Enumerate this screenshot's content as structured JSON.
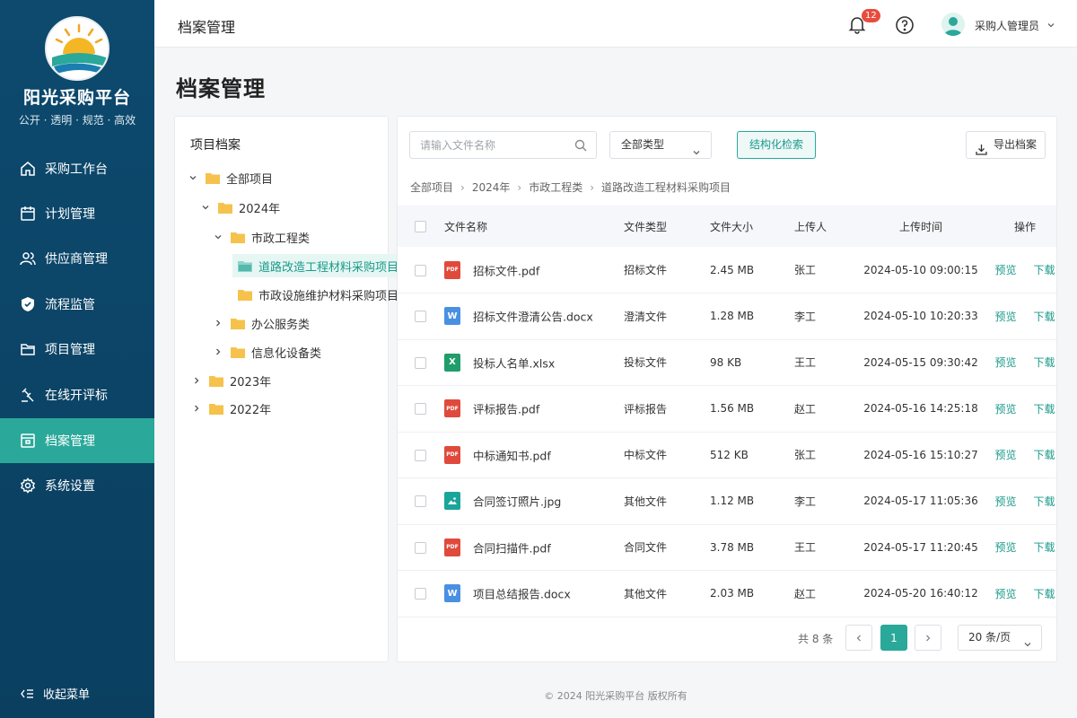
{
  "brand": {
    "title": "阳光采购平台",
    "subtitle": "公开 · 透明 · 规范 · 高效",
    "logo_icon": "sunrise-logo-icon"
  },
  "sidebar": {
    "items": [
      {
        "label": "采购工作台",
        "icon": "home-icon"
      },
      {
        "label": "计划管理",
        "icon": "calendar-icon"
      },
      {
        "label": "供应商管理",
        "icon": "users-icon"
      },
      {
        "label": "流程监管",
        "icon": "shield-icon"
      },
      {
        "label": "项目管理",
        "icon": "folder-icon"
      },
      {
        "label": "在线开评标",
        "icon": "gavel-icon"
      },
      {
        "label": "档案管理",
        "icon": "archive-icon",
        "active": true
      },
      {
        "label": "系统设置",
        "icon": "gear-icon"
      }
    ],
    "collapse_label": "收起菜单"
  },
  "header": {
    "title": "档案管理",
    "notification_count": "12",
    "user_name": "采购人管理员"
  },
  "page": {
    "title": "档案管理"
  },
  "tree": {
    "title": "项目档案",
    "nodes": [
      {
        "label": "全部项目",
        "expanded": true
      },
      {
        "label": "2024年",
        "expanded": true
      },
      {
        "label": "市政工程类",
        "expanded": true
      },
      {
        "label": "道路改造工程材料采购项目",
        "selected": true
      },
      {
        "label": "市政设施维护材料采购项目"
      },
      {
        "label": "办公服务类",
        "expanded": false
      },
      {
        "label": "信息化设备类",
        "expanded": false
      },
      {
        "label": "2023年",
        "expanded": false
      },
      {
        "label": "2022年",
        "expanded": false
      }
    ]
  },
  "toolbar": {
    "search_placeholder": "请输入文件名称",
    "type_select": "全部类型",
    "structured_search": "结构化检索",
    "export": "导出档案"
  },
  "breadcrumb": [
    "全部项目",
    "2024年",
    "市政工程类",
    "道路改造工程材料采购项目"
  ],
  "table": {
    "headers": [
      "文件名称",
      "文件类型",
      "文件大小",
      "上传人",
      "上传时间",
      "操作"
    ],
    "preview_label": "预览",
    "download_label": "下载",
    "rows": [
      {
        "name": "招标文件.pdf",
        "type": "招标文件",
        "size": "2.45 MB",
        "uploader": "张工",
        "time": "2024-05-10 09:00:15",
        "ftype": "pdf"
      },
      {
        "name": "招标文件澄清公告.docx",
        "type": "澄清文件",
        "size": "1.28 MB",
        "uploader": "李工",
        "time": "2024-05-10 10:20:33",
        "ftype": "docx"
      },
      {
        "name": "投标人名单.xlsx",
        "type": "投标文件",
        "size": "98 KB",
        "uploader": "王工",
        "time": "2024-05-15 09:30:42",
        "ftype": "xlsx"
      },
      {
        "name": "评标报告.pdf",
        "type": "评标报告",
        "size": "1.56 MB",
        "uploader": "赵工",
        "time": "2024-05-16 14:25:18",
        "ftype": "pdf"
      },
      {
        "name": "中标通知书.pdf",
        "type": "中标文件",
        "size": "512 KB",
        "uploader": "张工",
        "time": "2024-05-16 15:10:27",
        "ftype": "pdf"
      },
      {
        "name": "合同签订照片.jpg",
        "type": "其他文件",
        "size": "1.12 MB",
        "uploader": "李工",
        "time": "2024-05-17 11:05:36",
        "ftype": "jpg"
      },
      {
        "name": "合同扫描件.pdf",
        "type": "合同文件",
        "size": "3.78 MB",
        "uploader": "王工",
        "time": "2024-05-17 11:20:45",
        "ftype": "pdf"
      },
      {
        "name": "项目总结报告.docx",
        "type": "其他文件",
        "size": "2.03 MB",
        "uploader": "赵工",
        "time": "2024-05-20 16:40:12",
        "ftype": "docx"
      }
    ]
  },
  "pagination": {
    "total": "共 8 条",
    "current_page": "1",
    "page_size": "20 条/页"
  },
  "footer": {
    "copyright": "© 2024 阳光采购平台 版权所有"
  },
  "colors": {
    "sidebar_bg": "#0d4a6e",
    "accent": "#2aa89a",
    "pdf": "#e04a3c",
    "docx": "#4a90e2",
    "xlsx": "#1f9d6a",
    "jpg": "#1aa59a"
  }
}
